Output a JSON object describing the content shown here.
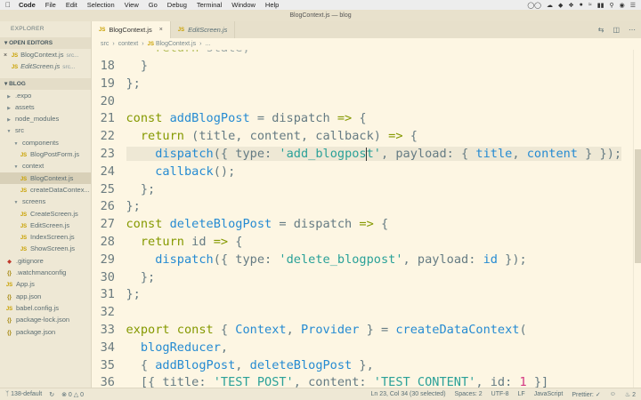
{
  "menubar": {
    "app": "Code",
    "items": [
      "File",
      "Edit",
      "Selection",
      "View",
      "Go",
      "Debug",
      "Terminal",
      "Window",
      "Help"
    ]
  },
  "window": {
    "title": "BlogContext.js — blog"
  },
  "sidebar": {
    "title": "EXPLORER",
    "open_editors_header": "OPEN EDITORS",
    "open_editors": [
      {
        "name": "BlogContext.js",
        "dir": "src...",
        "close": "×"
      },
      {
        "name": "EditScreen.js",
        "dir": "src..."
      }
    ],
    "project_header": "BLOG",
    "tree": [
      {
        "name": ".expo",
        "kind": "folder",
        "depth": 0
      },
      {
        "name": "assets",
        "kind": "folder",
        "depth": 0
      },
      {
        "name": "node_modules",
        "kind": "folder",
        "depth": 0
      },
      {
        "name": "src",
        "kind": "folder-open",
        "depth": 0
      },
      {
        "name": "components",
        "kind": "folder-open",
        "depth": 1
      },
      {
        "name": "BlogPostForm.js",
        "kind": "js",
        "depth": 2
      },
      {
        "name": "context",
        "kind": "folder-open",
        "depth": 1
      },
      {
        "name": "BlogContext.js",
        "kind": "js",
        "depth": 2,
        "selected": true
      },
      {
        "name": "createDataContex...",
        "kind": "js",
        "depth": 2
      },
      {
        "name": "screens",
        "kind": "folder-open",
        "depth": 1
      },
      {
        "name": "CreateScreen.js",
        "kind": "js",
        "depth": 2
      },
      {
        "name": "EditScreen.js",
        "kind": "js",
        "depth": 2
      },
      {
        "name": "IndexScreen.js",
        "kind": "js",
        "depth": 2
      },
      {
        "name": "ShowScreen.js",
        "kind": "js",
        "depth": 2
      },
      {
        "name": ".gitignore",
        "kind": "git",
        "depth": 0
      },
      {
        "name": ".watchmanconfig",
        "kind": "json",
        "depth": 0
      },
      {
        "name": "App.js",
        "kind": "js",
        "depth": 0
      },
      {
        "name": "app.json",
        "kind": "json",
        "depth": 0
      },
      {
        "name": "babel.config.js",
        "kind": "js",
        "depth": 0
      },
      {
        "name": "package-lock.json",
        "kind": "json",
        "depth": 0
      },
      {
        "name": "package.json",
        "kind": "json",
        "depth": 0
      }
    ]
  },
  "tabs": [
    {
      "label": "BlogContext.js",
      "active": true,
      "close": "×"
    },
    {
      "label": "EditScreen.js",
      "active": false
    }
  ],
  "breadcrumb": [
    "src",
    "context",
    "BlogContext.js",
    "..."
  ],
  "editor": {
    "lines": [
      {
        "n": "18",
        "tokens": [
          [
            "pl",
            "  }"
          ]
        ]
      },
      {
        "n": "19",
        "tokens": [
          [
            "pl",
            "};"
          ]
        ]
      },
      {
        "n": "20",
        "tokens": []
      },
      {
        "n": "21",
        "tokens": [
          [
            "kw",
            "const "
          ],
          [
            "fn",
            "addBlogPost"
          ],
          [
            "pl",
            " = dispatch "
          ],
          [
            "kw",
            "=>"
          ],
          [
            "pl",
            " {"
          ]
        ]
      },
      {
        "n": "22",
        "tokens": [
          [
            "kw",
            "  return"
          ],
          [
            "pl",
            " (title, content, callback) "
          ],
          [
            "kw",
            "=>"
          ],
          [
            "pl",
            " {"
          ]
        ]
      },
      {
        "n": "23",
        "tokens": [
          [
            "pl",
            "    "
          ],
          [
            "fn",
            "dispatch"
          ],
          [
            "pl",
            "({ type: "
          ],
          [
            "str",
            "'add_blogpos"
          ],
          [
            "cursor",
            ""
          ],
          [
            "str",
            "t'"
          ],
          [
            "pl",
            ", payload: { "
          ],
          [
            "fn",
            "title"
          ],
          [
            "pl",
            ", "
          ],
          [
            "fn",
            "content"
          ],
          [
            "pl",
            " } });"
          ]
        ],
        "highlight": true
      },
      {
        "n": "24",
        "tokens": [
          [
            "pl",
            "    "
          ],
          [
            "fn",
            "callback"
          ],
          [
            "pl",
            "();"
          ]
        ]
      },
      {
        "n": "25",
        "tokens": [
          [
            "pl",
            "  };"
          ]
        ]
      },
      {
        "n": "26",
        "tokens": [
          [
            "pl",
            "};"
          ]
        ]
      },
      {
        "n": "27",
        "tokens": [
          [
            "kw",
            "const "
          ],
          [
            "fn",
            "deleteBlogPost"
          ],
          [
            "pl",
            " = dispatch "
          ],
          [
            "kw",
            "=>"
          ],
          [
            "pl",
            " {"
          ]
        ]
      },
      {
        "n": "28",
        "tokens": [
          [
            "kw",
            "  return"
          ],
          [
            "pl",
            " id "
          ],
          [
            "kw",
            "=>"
          ],
          [
            "pl",
            " {"
          ]
        ]
      },
      {
        "n": "29",
        "tokens": [
          [
            "pl",
            "    "
          ],
          [
            "fn",
            "dispatch"
          ],
          [
            "pl",
            "({ type: "
          ],
          [
            "str",
            "'delete_blogpost'"
          ],
          [
            "pl",
            ", payload: "
          ],
          [
            "fn",
            "id"
          ],
          [
            "pl",
            " });"
          ]
        ]
      },
      {
        "n": "30",
        "tokens": [
          [
            "pl",
            "  };"
          ]
        ]
      },
      {
        "n": "31",
        "tokens": [
          [
            "pl",
            "};"
          ]
        ]
      },
      {
        "n": "32",
        "tokens": []
      },
      {
        "n": "33",
        "tokens": [
          [
            "kw",
            "export const"
          ],
          [
            "pl",
            " { "
          ],
          [
            "fn",
            "Context"
          ],
          [
            "pl",
            ", "
          ],
          [
            "fn",
            "Provider"
          ],
          [
            "pl",
            " } = "
          ],
          [
            "fn",
            "createDataContext"
          ],
          [
            "pl",
            "("
          ]
        ]
      },
      {
        "n": "34",
        "tokens": [
          [
            "pl",
            "  "
          ],
          [
            "fn",
            "blogReducer"
          ],
          [
            "pl",
            ","
          ]
        ]
      },
      {
        "n": "35",
        "tokens": [
          [
            "pl",
            "  { "
          ],
          [
            "fn",
            "addBlogPost"
          ],
          [
            "pl",
            ", "
          ],
          [
            "fn",
            "deleteBlogPost"
          ],
          [
            "pl",
            " },"
          ]
        ]
      },
      {
        "n": "36",
        "tokens": [
          [
            "pl",
            "  [{ title: "
          ],
          [
            "str",
            "'TEST POST'"
          ],
          [
            "pl",
            ", content: "
          ],
          [
            "str",
            "'TEST CONTENT'"
          ],
          [
            "pl",
            ", id: "
          ],
          [
            "num",
            "1"
          ],
          [
            "pl",
            " }]"
          ]
        ]
      }
    ]
  },
  "statusbar": {
    "branch": "138-default",
    "errors": "0",
    "warnings": "0",
    "position": "Ln 23, Col 34 (30 selected)",
    "spaces": "Spaces: 2",
    "encoding": "UTF-8",
    "eol": "LF",
    "language": "JavaScript",
    "prettier": "Prettier: ✓",
    "notifications": "2"
  }
}
